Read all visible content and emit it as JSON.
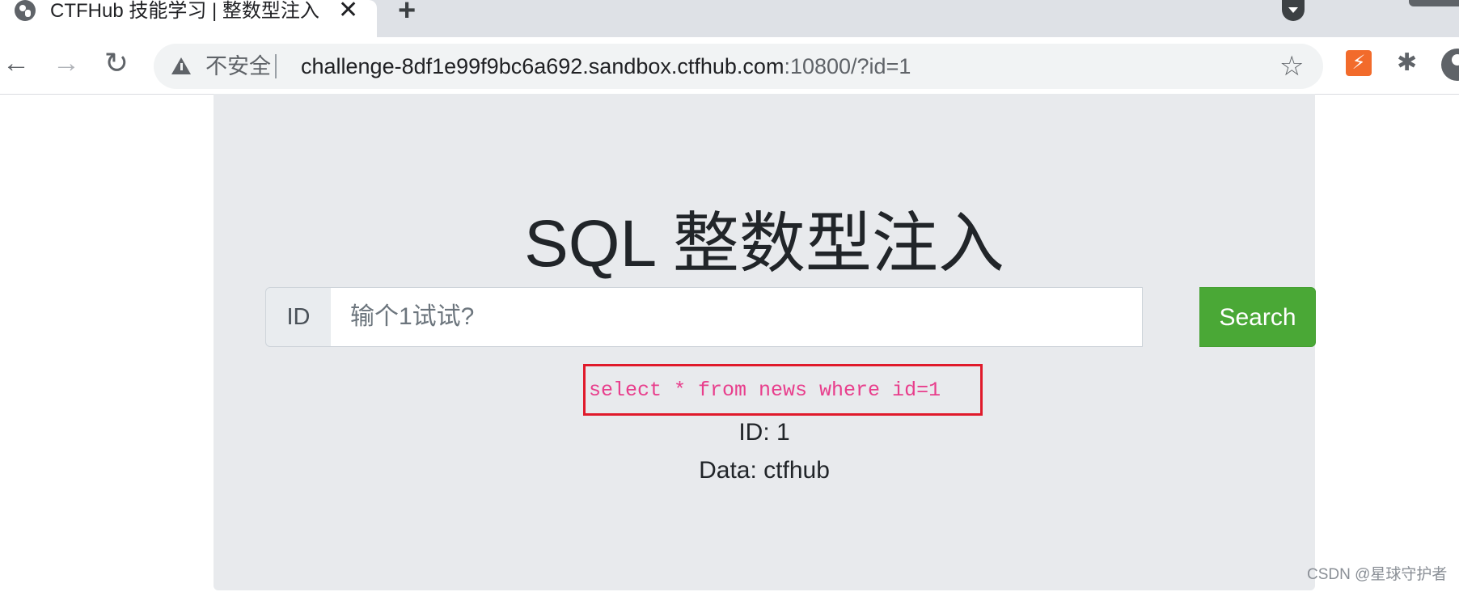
{
  "browser": {
    "tab": {
      "title": "CTFHub 技能学习 | 整数型注入",
      "close_glyph": "✕"
    },
    "new_tab_glyph": "+",
    "nav": {
      "back_glyph": "←",
      "forward_glyph": "→",
      "reload_glyph": "↻"
    },
    "omnibox": {
      "security_label": "不安全",
      "url_host": "challenge-8df1e99f9bc6a692.sandbox.ctfhub.com",
      "url_rest": ":10800/?id=1"
    },
    "star_glyph": "☆",
    "extension_glyph": "⚡",
    "puzzle_glyph": "✱",
    "icons": [
      "globe-icon",
      "close-icon",
      "plus-icon",
      "tab-search-icon",
      "back-arrow-icon",
      "forward-arrow-icon",
      "reload-icon",
      "warning-icon",
      "star-icon",
      "extension-icon",
      "puzzle-icon",
      "profile-icon"
    ]
  },
  "page": {
    "title": "SQL 整数型注入",
    "search": {
      "prepend_label": "ID",
      "placeholder": "输个1试试?",
      "value": "",
      "button_label": "Search"
    },
    "query": "select * from news where id=1",
    "result": {
      "id_line": "ID: 1",
      "data_line": "Data: ctfhub"
    },
    "colors": {
      "search_button": "#4aa836",
      "query_text": "#e83e8c",
      "highlight_border": "#e01a2b",
      "jumbotron_bg": "#e8eaed"
    }
  },
  "watermark": "CSDN @星球守护者"
}
